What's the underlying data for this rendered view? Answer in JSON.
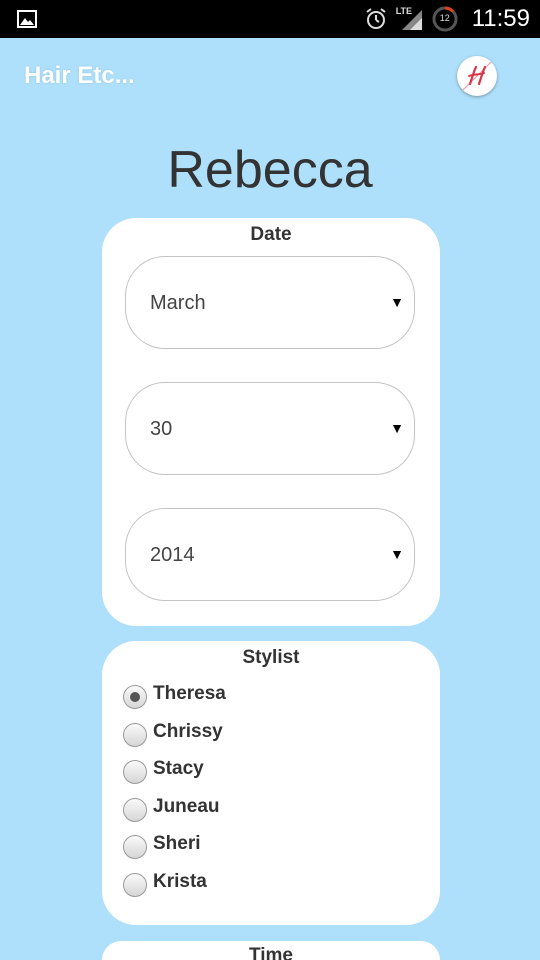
{
  "status_bar": {
    "network": "LTE",
    "battery_level": "12",
    "time": "11:59"
  },
  "app": {
    "title": "Hair Etc...",
    "logo_letter": "H"
  },
  "client_name": "Rebecca",
  "date_card": {
    "title": "Date",
    "month": "March",
    "day": "30",
    "year": "2014"
  },
  "stylist_card": {
    "title": "Stylist",
    "options": [
      "Theresa",
      "Chrissy",
      "Stacy",
      "Juneau",
      "Sheri",
      "Krista"
    ],
    "selected": "Theresa"
  },
  "time_card": {
    "title": "Time"
  },
  "colors": {
    "background": "#aee0fc",
    "card": "#ffffff",
    "text": "#333333"
  }
}
